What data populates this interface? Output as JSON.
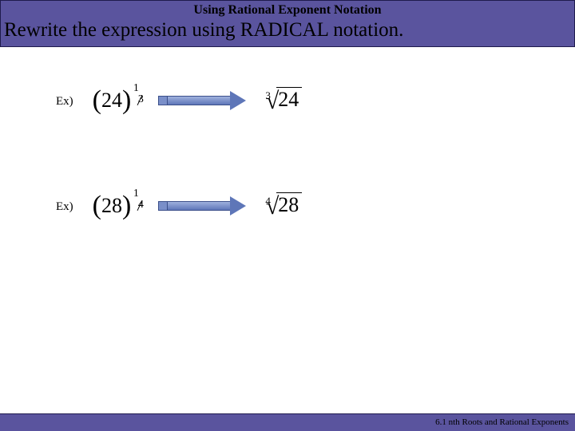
{
  "header": {
    "title": "Using Rational Exponent Notation",
    "subtitle": "Rewrite the expression using RADICAL notation."
  },
  "examples": [
    {
      "label": "Ex)",
      "base": "24",
      "exp_num": "1",
      "exp_den": "3",
      "radical_index": "3",
      "radicand": "24"
    },
    {
      "label": "Ex)",
      "base": "28",
      "exp_num": "1",
      "exp_den": "4",
      "radical_index": "4",
      "radicand": "28"
    }
  ],
  "footer": "6.1 nth Roots and Rational Exponents"
}
